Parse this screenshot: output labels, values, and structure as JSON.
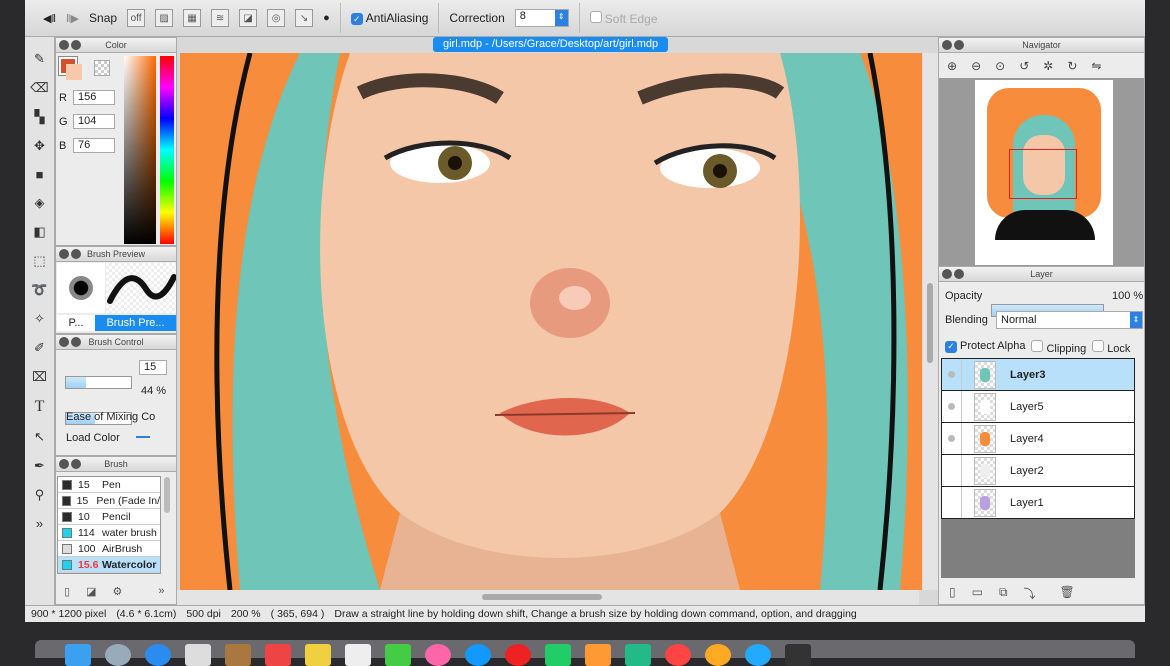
{
  "toolbar": {
    "snap_label": "Snap",
    "antialiasing_label": "AntiAliasing",
    "antialiasing_checked": true,
    "correction_label": "Correction",
    "correction_value": "8",
    "soft_edge_label": "Soft Edge",
    "soft_edge_checked": false
  },
  "document_tab": "girl.mdp - /Users/Grace/Desktop/art/girl.mdp",
  "color_panel": {
    "title": "Color",
    "r_label": "R",
    "r": "156",
    "g_label": "G",
    "g": "104",
    "b_label": "B",
    "b": "76",
    "current_color": "#9c684c"
  },
  "brush_preview": {
    "title": "Brush Preview",
    "tab1": "P...",
    "tab2": "Brush Pre..."
  },
  "brush_control": {
    "title": "Brush Control",
    "size": "15",
    "size_fraction": 0.3,
    "opacity": "44 %",
    "opacity_fraction": 0.44,
    "ease_label": "Ease of Mixing Co",
    "load_label": "Load Color"
  },
  "brush_panel": {
    "title": "Brush",
    "items": [
      {
        "size": "15",
        "name": "Pen",
        "color": "#2b2b2b"
      },
      {
        "size": "15",
        "name": "Pen (Fade In/",
        "color": "#2b2b2b"
      },
      {
        "size": "10",
        "name": "Pencil",
        "color": "#2b2b2b"
      },
      {
        "size": "114",
        "name": "water brush",
        "color": "#19d3f0"
      },
      {
        "size": "100",
        "name": "AirBrush",
        "color": "#dddddd"
      },
      {
        "size": "15.6",
        "name": "Watercolor",
        "color": "#19d3f0",
        "selected": true
      }
    ]
  },
  "navigator": {
    "title": "Navigator"
  },
  "layer_panel": {
    "title": "Layer",
    "opacity_label": "Opacity",
    "opacity": "100 %",
    "blending_label": "Blending",
    "blending": "Normal",
    "protect_alpha": "Protect Alpha",
    "clipping": "Clipping",
    "lock": "Lock",
    "layers": [
      {
        "name": "Layer3",
        "selected": true,
        "visible_dot": true
      },
      {
        "name": "Layer5",
        "visible_dot": true
      },
      {
        "name": "Layer4",
        "visible_dot": true
      },
      {
        "name": "Layer2"
      },
      {
        "name": "Layer1"
      }
    ]
  },
  "status": {
    "size": "900 * 1200 pixel",
    "cm": "(4.6 * 6.1cm)",
    "dpi": "500 dpi",
    "zoom": "200 %",
    "coords": "( 365, 694 )",
    "hint": "Draw a straight line by holding down shift, Change a brush size by holding down command, option, and dragging"
  }
}
